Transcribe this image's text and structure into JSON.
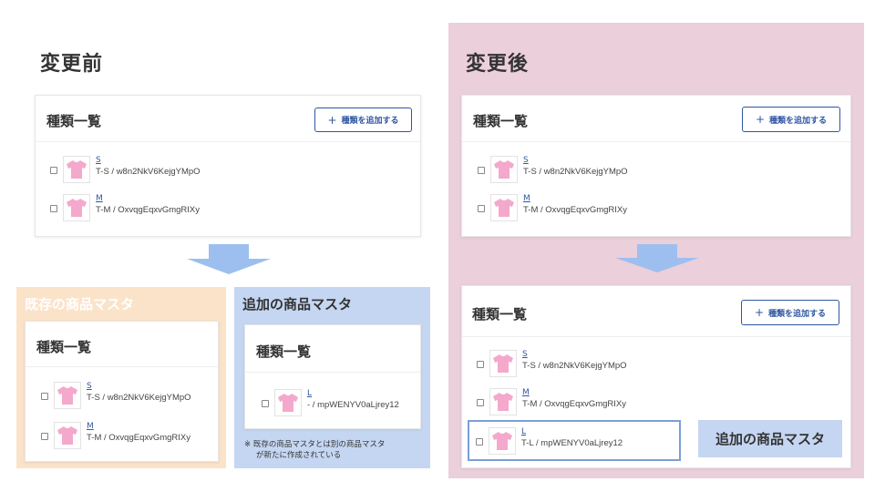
{
  "colors": {
    "after_bg": "#ebcfdb",
    "existing_panel_bg": "#fbe3c9",
    "added_panel_bg": "#c5d6f2",
    "arrow": "#9dbfef",
    "accent_blue": "#2f56a3",
    "highlight_border": "#7a9fd6",
    "shirt_pink": "#f4a8cc"
  },
  "before": {
    "title": "変更前"
  },
  "after": {
    "title": "変更後"
  },
  "card": {
    "title": "種類一覧",
    "add_button_label": "種類を追加する",
    "add_button_icon": "plus-icon"
  },
  "items": {
    "s": {
      "name": "S",
      "detail": "T-S / w8n2NkV6KejgYMpO",
      "icon": "tshirt-icon"
    },
    "m": {
      "name": "M",
      "detail": "T-M / OxvqgEqxvGmgRIXy",
      "icon": "tshirt-icon"
    },
    "l": {
      "name": "L",
      "detail": "T-L / mpWENYV0aLjrey12",
      "icon": "tshirt-icon"
    },
    "l_new": {
      "name": "L",
      "detail": "- / mpWENYV0aLjrey12",
      "icon": "tshirt-icon"
    }
  },
  "existing_master": {
    "label": "既存の商品マスタ"
  },
  "added_master": {
    "label": "追加の商品マスタ",
    "note_line1": "※ 既存の商品マスタとは別の商品マスタ",
    "note_line2": "が新たに作成されている"
  },
  "callout": {
    "label": "追加の商品マスタ"
  }
}
